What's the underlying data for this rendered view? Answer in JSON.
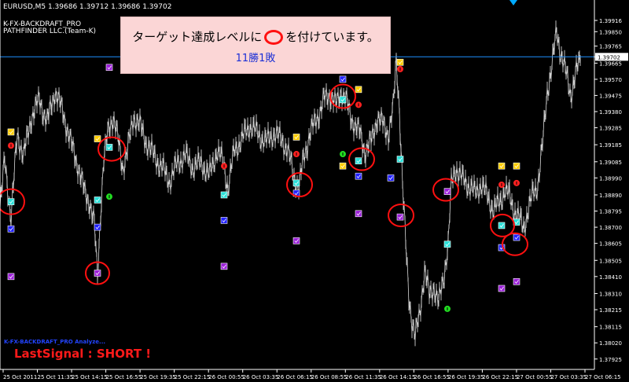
{
  "header": {
    "symbol_line": "EURUSD,M5  1.39686 1.39712 1.39686 1.39702",
    "indicator_line": "K-FX-BACKDRAFT_PRO",
    "company_line": "PATHFINDER LLC.(Team-K)"
  },
  "notice": {
    "line1_before": "ターゲット達成レベルに",
    "line1_after": "を付けています。",
    "line2": "11勝1敗"
  },
  "bottom_left": {
    "analyzer": "K-FX-BACKDRAFT_PRO Analyze...",
    "last_signal": "LastSignal : SHORT !"
  },
  "colors": {
    "background": "#000000",
    "price_bars": "#bdbdbd",
    "current_price_line": "#1e90ff",
    "circle": "#ff1010",
    "axis": "#ffffff"
  },
  "chart_data": {
    "type": "line",
    "symbol": "EURUSD",
    "timeframe": "M5",
    "ylim": [
      1.3791,
      1.3999
    ],
    "current_price": 1.39702,
    "y_ticks": [
      "1.39916",
      "1.39850",
      "1.39765",
      "1.39702",
      "1.39665",
      "1.39570",
      "1.39475",
      "1.39380",
      "1.39285",
      "1.39185",
      "1.39085",
      "1.38990",
      "1.38890",
      "1.38795",
      "1.38700",
      "1.38605",
      "1.38505",
      "1.38410",
      "1.38310",
      "1.38215",
      "1.38115",
      "1.38020",
      "1.37925"
    ],
    "x_ticks": [
      "25 Oct 2011",
      "25 Oct 11:35",
      "25 Oct 14:15",
      "25 Oct 16:55",
      "25 Oct 19:35",
      "25 Oct 22:15",
      "26 Oct 00:55",
      "26 Oct 03:35",
      "26 Oct 06:15",
      "26 Oct 08:55",
      "26 Oct 11:35",
      "26 Oct 14:15",
      "26 Oct 16:55",
      "26 Oct 19:35",
      "26 Oct 22:15",
      "27 Oct 00:55",
      "27 Oct 03:35",
      "27 Oct 06:15"
    ],
    "price_series": [
      [
        0,
        1.388
      ],
      [
        6,
        1.391
      ],
      [
        14,
        1.3875
      ],
      [
        22,
        1.3925
      ],
      [
        30,
        1.3912
      ],
      [
        40,
        1.3935
      ],
      [
        50,
        1.3945
      ],
      [
        60,
        1.3932
      ],
      [
        70,
        1.395
      ],
      [
        80,
        1.3938
      ],
      [
        90,
        1.392
      ],
      [
        100,
        1.3905
      ],
      [
        108,
        1.389
      ],
      [
        114,
        1.3885
      ],
      [
        120,
        1.3872
      ],
      [
        124,
        1.384
      ],
      [
        128,
        1.388
      ],
      [
        132,
        1.391
      ],
      [
        138,
        1.3928
      ],
      [
        144,
        1.3935
      ],
      [
        150,
        1.3922
      ],
      [
        156,
        1.3905
      ],
      [
        162,
        1.3915
      ],
      [
        170,
        1.3935
      ],
      [
        178,
        1.393
      ],
      [
        186,
        1.392
      ],
      [
        196,
        1.3912
      ],
      [
        206,
        1.3905
      ],
      [
        216,
        1.3897
      ],
      [
        226,
        1.3908
      ],
      [
        236,
        1.3912
      ],
      [
        246,
        1.3905
      ],
      [
        256,
        1.3908
      ],
      [
        266,
        1.39
      ],
      [
        276,
        1.3915
      ],
      [
        284,
        1.3908
      ],
      [
        290,
        1.3893
      ],
      [
        298,
        1.3915
      ],
      [
        308,
        1.3922
      ],
      [
        318,
        1.393
      ],
      [
        328,
        1.3925
      ],
      [
        338,
        1.392
      ],
      [
        348,
        1.3925
      ],
      [
        358,
        1.3922
      ],
      [
        366,
        1.3915
      ],
      [
        374,
        1.39
      ],
      [
        380,
        1.3893
      ],
      [
        386,
        1.391
      ],
      [
        394,
        1.3925
      ],
      [
        404,
        1.3935
      ],
      [
        412,
        1.3945
      ],
      [
        420,
        1.3948
      ],
      [
        428,
        1.3942
      ],
      [
        434,
        1.395
      ],
      [
        440,
        1.3945
      ],
      [
        446,
        1.3935
      ],
      [
        452,
        1.393
      ],
      [
        458,
        1.3925
      ],
      [
        464,
        1.3915
      ],
      [
        472,
        1.392
      ],
      [
        480,
        1.3935
      ],
      [
        488,
        1.393
      ],
      [
        494,
        1.3925
      ],
      [
        500,
        1.394
      ],
      [
        504,
        1.3968
      ],
      [
        508,
        1.394
      ],
      [
        512,
        1.3895
      ],
      [
        516,
        1.386
      ],
      [
        520,
        1.383
      ],
      [
        524,
        1.3815
      ],
      [
        528,
        1.3805
      ],
      [
        534,
        1.382
      ],
      [
        540,
        1.3845
      ],
      [
        546,
        1.383
      ],
      [
        552,
        1.3835
      ],
      [
        558,
        1.3825
      ],
      [
        564,
        1.384
      ],
      [
        570,
        1.386
      ],
      [
        574,
        1.3895
      ],
      [
        580,
        1.3905
      ],
      [
        588,
        1.3898
      ],
      [
        596,
        1.3895
      ],
      [
        604,
        1.389
      ],
      [
        612,
        1.3895
      ],
      [
        620,
        1.3888
      ],
      [
        628,
        1.388
      ],
      [
        636,
        1.3885
      ],
      [
        642,
        1.3892
      ],
      [
        648,
        1.3888
      ],
      [
        654,
        1.388
      ],
      [
        660,
        1.3875
      ],
      [
        666,
        1.387
      ],
      [
        672,
        1.388
      ],
      [
        678,
        1.389
      ],
      [
        684,
        1.3895
      ],
      [
        690,
        1.3918
      ],
      [
        696,
        1.395
      ],
      [
        702,
        1.3965
      ],
      [
        708,
        1.3985
      ],
      [
        712,
        1.3975
      ],
      [
        716,
        1.3968
      ],
      [
        720,
        1.396
      ],
      [
        726,
        1.3948
      ],
      [
        732,
        1.396
      ],
      [
        738,
        1.3968
      ]
    ],
    "signals": [
      {
        "kind": "cyan",
        "t": 14,
        "p": 1.3885
      },
      {
        "kind": "blue",
        "t": 14,
        "p": 1.3869
      },
      {
        "kind": "purple",
        "t": 14,
        "p": 1.3841
      },
      {
        "kind": "yellow",
        "t": 14,
        "p": 1.3926
      },
      {
        "kind": "red-dot",
        "t": 14,
        "p": 1.3918
      },
      {
        "kind": "purple",
        "t": 139,
        "p": 1.3964
      },
      {
        "kind": "yellow",
        "t": 124,
        "p": 1.3922
      },
      {
        "kind": "cyan",
        "t": 139,
        "p": 1.3917
      },
      {
        "kind": "cyan",
        "t": 124,
        "p": 1.3886
      },
      {
        "kind": "blue",
        "t": 124,
        "p": 1.387
      },
      {
        "kind": "purple",
        "t": 124,
        "p": 1.3843
      },
      {
        "kind": "green-dot",
        "t": 139,
        "p": 1.3888
      },
      {
        "kind": "cyan",
        "t": 285,
        "p": 1.3889
      },
      {
        "kind": "blue",
        "t": 285,
        "p": 1.3874
      },
      {
        "kind": "purple",
        "t": 285,
        "p": 1.3847
      },
      {
        "kind": "red-dot",
        "t": 285,
        "p": 1.3906
      },
      {
        "kind": "yellow",
        "t": 377,
        "p": 1.3923
      },
      {
        "kind": "red-dot",
        "t": 377,
        "p": 1.3913
      },
      {
        "kind": "cyan",
        "t": 377,
        "p": 1.3896
      },
      {
        "kind": "blue",
        "t": 377,
        "p": 1.389
      },
      {
        "kind": "purple",
        "t": 377,
        "p": 1.3862
      },
      {
        "kind": "blue",
        "t": 436,
        "p": 1.3957
      },
      {
        "kind": "cyan",
        "t": 436,
        "p": 1.3945
      },
      {
        "kind": "yellow",
        "t": 456,
        "p": 1.3951
      },
      {
        "kind": "red-dot",
        "t": 456,
        "p": 1.3942
      },
      {
        "kind": "green-dot",
        "t": 436,
        "p": 1.3913
      },
      {
        "kind": "yellow",
        "t": 436,
        "p": 1.3906
      },
      {
        "kind": "cyan",
        "t": 456,
        "p": 1.3909
      },
      {
        "kind": "blue",
        "t": 456,
        "p": 1.39
      },
      {
        "kind": "purple",
        "t": 456,
        "p": 1.3878
      },
      {
        "kind": "yellow",
        "t": 509,
        "p": 1.3967
      },
      {
        "kind": "red-dot",
        "t": 509,
        "p": 1.3963
      },
      {
        "kind": "cyan",
        "t": 509,
        "p": 1.391
      },
      {
        "kind": "blue",
        "t": 497,
        "p": 1.3899
      },
      {
        "kind": "purple",
        "t": 509,
        "p": 1.3876
      },
      {
        "kind": "purple",
        "t": 569,
        "p": 1.3891
      },
      {
        "kind": "cyan",
        "t": 569,
        "p": 1.386
      },
      {
        "kind": "green-dot",
        "t": 569,
        "p": 1.3822
      },
      {
        "kind": "yellow",
        "t": 638,
        "p": 1.3906
      },
      {
        "kind": "yellow",
        "t": 657,
        "p": 1.3906
      },
      {
        "kind": "red-dot",
        "t": 638,
        "p": 1.3895
      },
      {
        "kind": "red-dot",
        "t": 657,
        "p": 1.3896
      },
      {
        "kind": "cyan",
        "t": 638,
        "p": 1.3871
      },
      {
        "kind": "cyan",
        "t": 657,
        "p": 1.3873
      },
      {
        "kind": "blue",
        "t": 638,
        "p": 1.3858
      },
      {
        "kind": "blue",
        "t": 657,
        "p": 1.3864
      },
      {
        "kind": "purple",
        "t": 638,
        "p": 1.3834
      },
      {
        "kind": "purple",
        "t": 657,
        "p": 1.3838
      }
    ],
    "circles": [
      {
        "t": 14,
        "p": 1.3885,
        "rx": 17,
        "ry": 16
      },
      {
        "t": 124,
        "p": 1.3843,
        "rx": 15,
        "ry": 14
      },
      {
        "t": 142,
        "p": 1.3916,
        "rx": 17,
        "ry": 15
      },
      {
        "t": 381,
        "p": 1.3895,
        "rx": 16,
        "ry": 15
      },
      {
        "t": 436,
        "p": 1.3947,
        "rx": 16,
        "ry": 15
      },
      {
        "t": 460,
        "p": 1.391,
        "rx": 16,
        "ry": 14
      },
      {
        "t": 510,
        "p": 1.3877,
        "rx": 16,
        "ry": 14
      },
      {
        "t": 567,
        "p": 1.3892,
        "rx": 16,
        "ry": 14
      },
      {
        "t": 639,
        "p": 1.3871,
        "rx": 15,
        "ry": 14
      },
      {
        "t": 655,
        "p": 1.386,
        "rx": 16,
        "ry": 14
      }
    ]
  }
}
